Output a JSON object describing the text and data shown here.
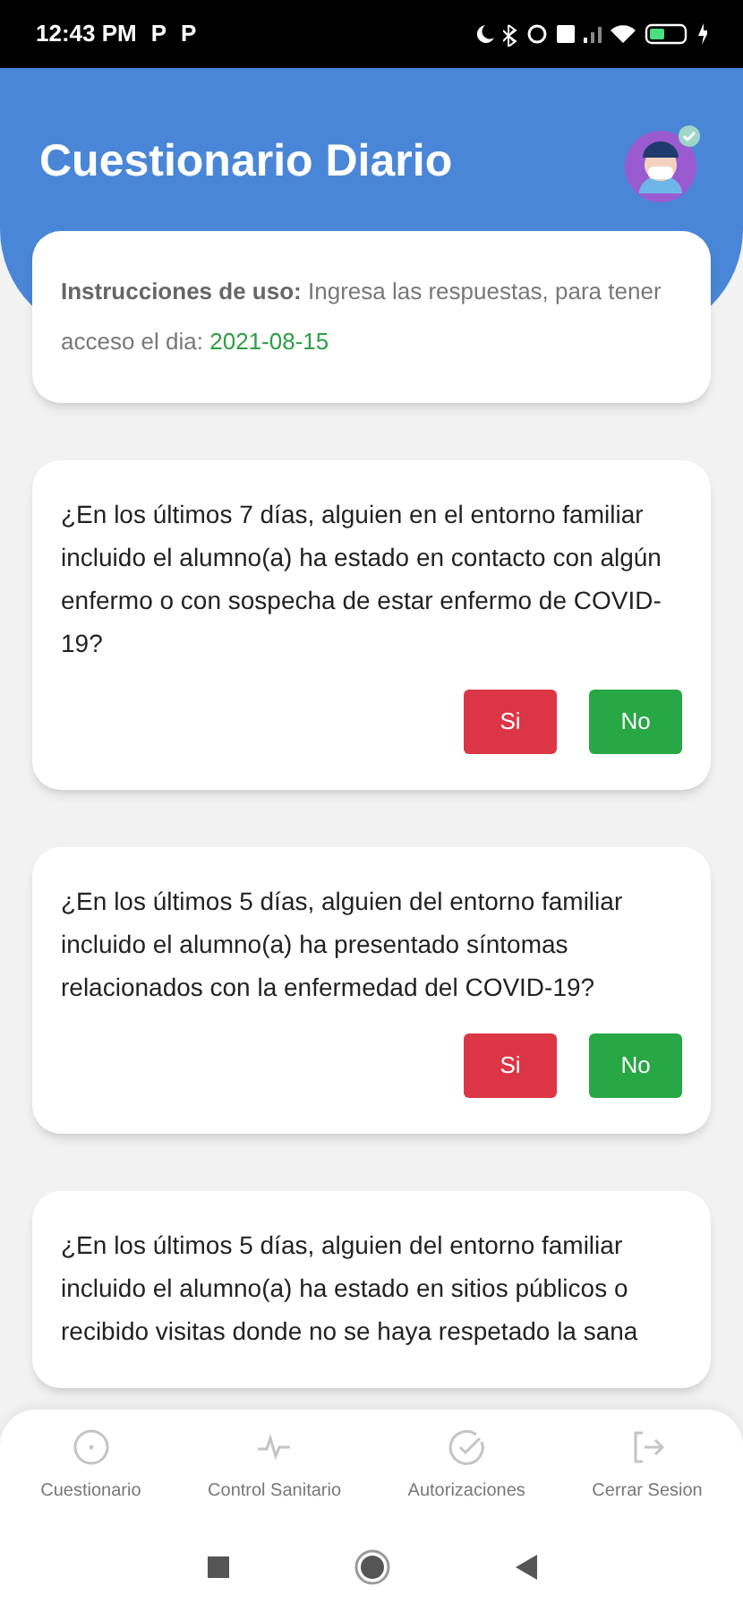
{
  "status_bar": {
    "time": "12:43 PM",
    "notifications": [
      "P",
      "P"
    ]
  },
  "header": {
    "title": "Cuestionario Diario"
  },
  "instructions": {
    "label": "Instrucciones de uso:",
    "text": "Ingresa las respuestas, para tener acceso el dia:",
    "date": "2021-08-15"
  },
  "questions": [
    {
      "text": "¿En los últimos 7 días, alguien en el entorno familiar incluido el alumno(a) ha estado en contacto con algún enfermo o con sospecha de estar enfermo de COVID-19?",
      "answers": [
        {
          "label": "Si",
          "kind": "yes"
        },
        {
          "label": "No",
          "kind": "no"
        }
      ]
    },
    {
      "text": "¿En los últimos 5 días, alguien del entorno familiar incluido el alumno(a) ha presentado síntomas relacionados con la enfermedad del COVID-19?",
      "answers": [
        {
          "label": "Si",
          "kind": "yes"
        },
        {
          "label": "No",
          "kind": "no"
        }
      ]
    },
    {
      "text": "¿En los últimos 5 días, alguien del entorno familiar incluido el alumno(a) ha estado en sitios públicos o recibido visitas donde no se haya respetado la sana"
    }
  ],
  "bottom_nav": [
    {
      "label": "Cuestionario",
      "kind": "circle"
    },
    {
      "label": "Control Sanitario",
      "kind": "pulse"
    },
    {
      "label": "Autorizaciones",
      "kind": "check"
    },
    {
      "label": "Cerrar Sesion",
      "kind": "logout"
    }
  ]
}
